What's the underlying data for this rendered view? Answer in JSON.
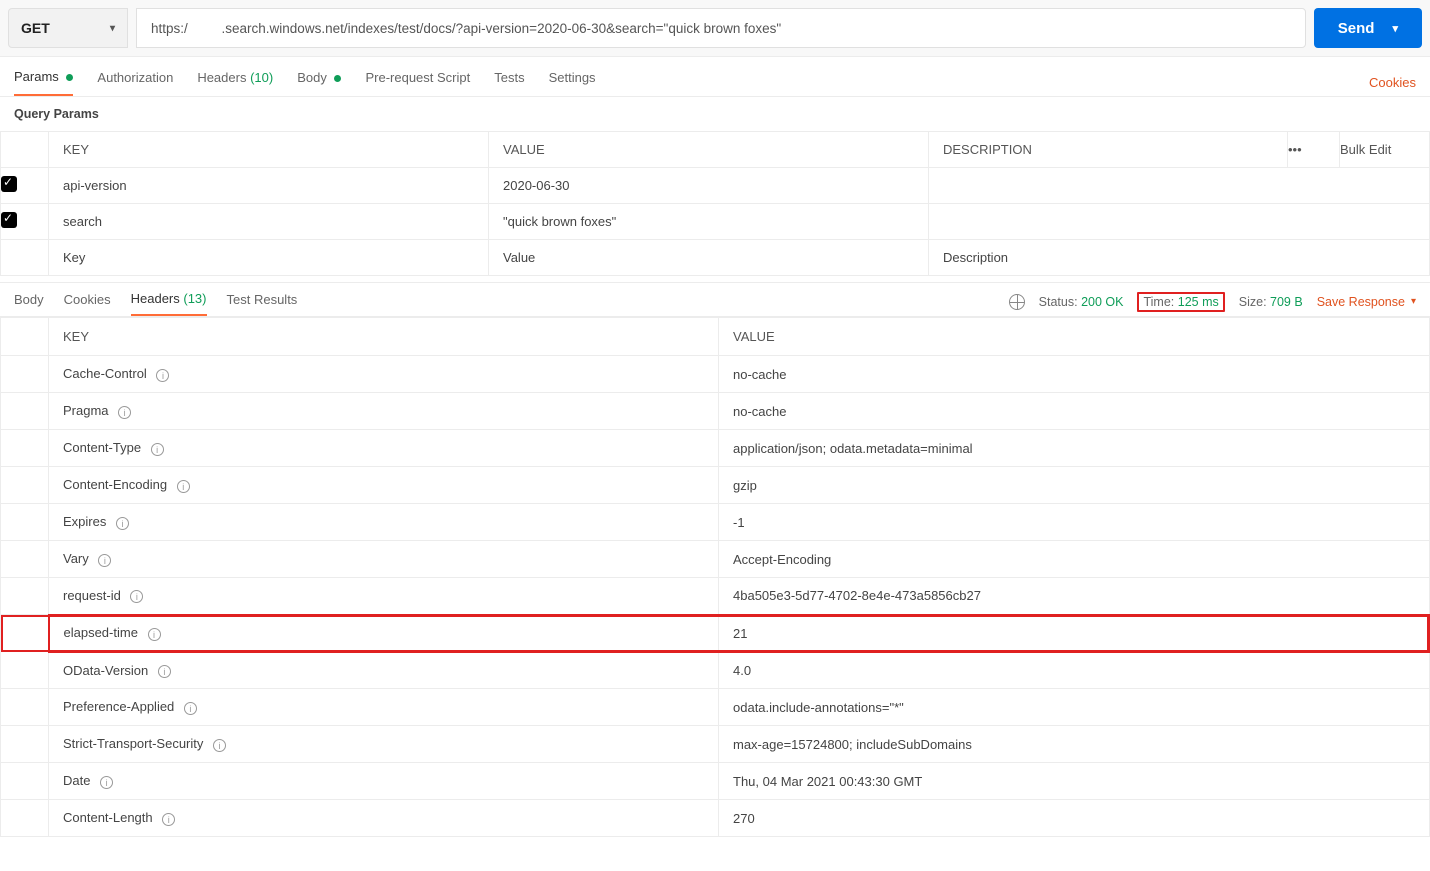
{
  "request": {
    "method": "GET",
    "url": "https:/         .search.windows.net/indexes/test/docs/?api-version=2020-06-30&search=\"quick brown foxes\"",
    "send_label": "Send"
  },
  "top_tabs": {
    "params": "Params",
    "authorization": "Authorization",
    "headers": "Headers",
    "headers_count": "(10)",
    "body": "Body",
    "pre_request": "Pre-request Script",
    "tests": "Tests",
    "settings": "Settings",
    "cookies": "Cookies"
  },
  "query_params": {
    "title": "Query Params",
    "columns": {
      "key": "KEY",
      "value": "VALUE",
      "desc": "DESCRIPTION",
      "bulk": "Bulk Edit"
    },
    "rows": [
      {
        "enabled": true,
        "key": "api-version",
        "value": "2020-06-30",
        "desc": ""
      },
      {
        "enabled": true,
        "key": "search",
        "value": "\"quick brown foxes\"",
        "desc": ""
      }
    ],
    "placeholders": {
      "key": "Key",
      "value": "Value",
      "desc": "Description"
    }
  },
  "response_tabs": {
    "body": "Body",
    "cookies": "Cookies",
    "headers": "Headers",
    "headers_count": "(13)",
    "test_results": "Test Results"
  },
  "response_meta": {
    "status_label": "Status:",
    "status_value": "200 OK",
    "time_label": "Time:",
    "time_value": "125 ms",
    "size_label": "Size:",
    "size_value": "709 B",
    "save": "Save Response"
  },
  "response_headers": {
    "columns": {
      "key": "KEY",
      "value": "VALUE"
    },
    "rows": [
      {
        "key": "Cache-Control",
        "value": "no-cache"
      },
      {
        "key": "Pragma",
        "value": "no-cache"
      },
      {
        "key": "Content-Type",
        "value": "application/json; odata.metadata=minimal"
      },
      {
        "key": "Content-Encoding",
        "value": "gzip"
      },
      {
        "key": "Expires",
        "value": "-1"
      },
      {
        "key": "Vary",
        "value": "Accept-Encoding"
      },
      {
        "key": "request-id",
        "value": "4ba505e3-5d77-4702-8e4e-473a5856cb27"
      },
      {
        "key": "elapsed-time",
        "value": "21",
        "highlight": true
      },
      {
        "key": "OData-Version",
        "value": "4.0"
      },
      {
        "key": "Preference-Applied",
        "value": "odata.include-annotations=\"*\""
      },
      {
        "key": "Strict-Transport-Security",
        "value": "max-age=15724800; includeSubDomains"
      },
      {
        "key": "Date",
        "value": "Thu, 04 Mar 2021 00:43:30 GMT"
      },
      {
        "key": "Content-Length",
        "value": "270"
      }
    ]
  }
}
